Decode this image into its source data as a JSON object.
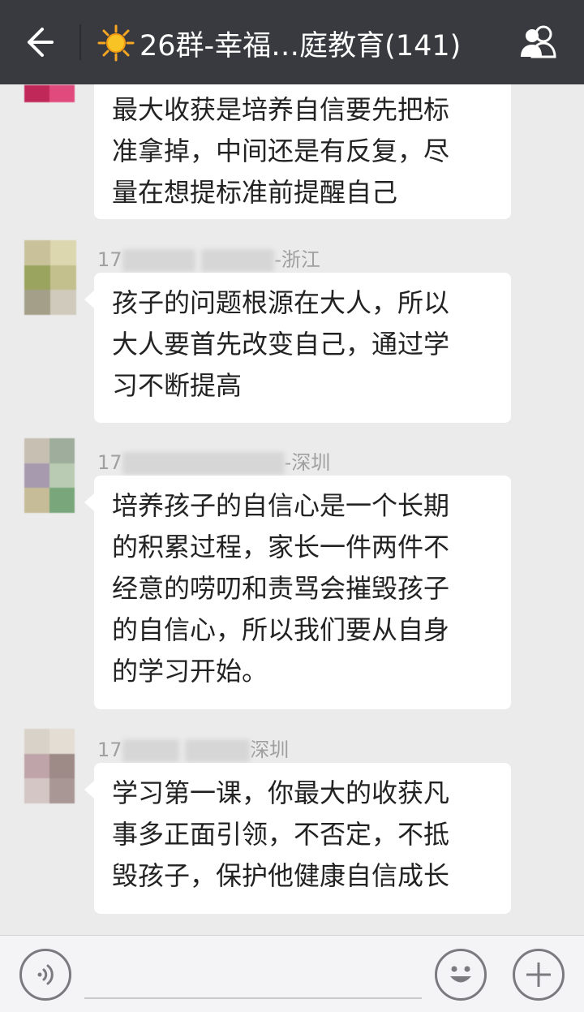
{
  "header": {
    "title": "26群-幸福…庭教育(141)",
    "back_icon": "back-arrow-icon",
    "sun_icon": "sun-emoji-icon",
    "group_icon": "group-members-icon",
    "bg_color": "#393a3f"
  },
  "messages": [
    {
      "sender_meta": "",
      "text": "最大收获是培养自信要先把标\n准拿掉，中间还是有反复，尽\n量在想提标准前提醒自己"
    },
    {
      "sender_meta_prefix": "17",
      "sender_meta_suffix": "-浙江",
      "text": "孩子的问题根源在大人，所以\n大人要首先改变自己，通过学\n习不断提高"
    },
    {
      "sender_meta_prefix": "17",
      "sender_meta_suffix": "-深圳",
      "text": "培养孩子的自信心是一个长期\n的积累过程，家长一件两件不\n经意的唠叨和责骂会摧毁孩子\n的自信心，所以我们要从自身\n的学习开始。"
    },
    {
      "sender_meta_prefix": "17",
      "sender_meta_suffix": "深圳",
      "text": "学习第一课，你最大的收获凡\n事多正面引领，不否定，不抵\n毁孩子，保护他健康自信成长"
    }
  ],
  "bottombar": {
    "voice_icon": "voice-input-icon",
    "emoji_icon": "emoji-icon",
    "plus_icon": "plus-icon"
  }
}
